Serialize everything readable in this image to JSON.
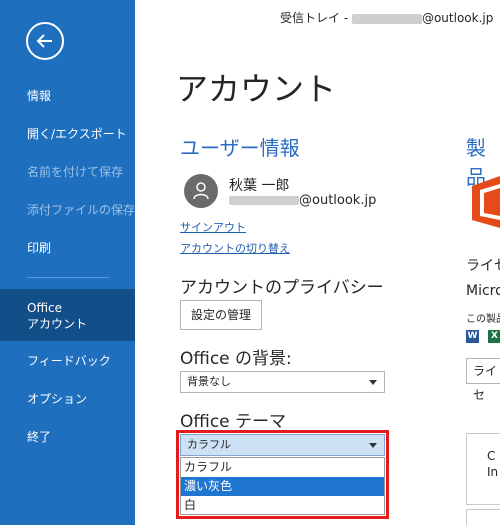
{
  "window": {
    "title_prefix": "受信トレイ - ",
    "title_suffix": "@outlook.jp"
  },
  "sidebar": {
    "items": [
      {
        "label": "情報"
      },
      {
        "label": "開く/エクスポート"
      },
      {
        "label": "名前を付けて保存"
      },
      {
        "label": "添付ファイルの保存"
      },
      {
        "label": "印刷"
      },
      {
        "label_line1": "Office",
        "label_line2": "アカウント"
      },
      {
        "label": "フィードバック"
      },
      {
        "label": "オプション"
      },
      {
        "label": "終了"
      }
    ]
  },
  "main": {
    "page_title": "アカウント",
    "user_info": {
      "section_title": "ユーザー情報",
      "name": "秋葉 一郎",
      "email_suffix": "@outlook.jp",
      "sign_out": "サインアウト",
      "switch_account": "アカウントの切り替え"
    },
    "privacy": {
      "heading": "アカウントのプライバシー",
      "manage_button": "設定の管理"
    },
    "background": {
      "heading": "Office の背景:",
      "selected": "背景なし"
    },
    "theme": {
      "heading": "Office テーマ",
      "selected": "カラフル",
      "options": [
        "カラフル",
        "濃い灰色",
        "白"
      ],
      "highlighted_option": "濃い灰色"
    }
  },
  "product_panel": {
    "section_title": "製品",
    "line1": "ライセ",
    "line2": "Micro",
    "line3": "この製品",
    "button_label": "ライセ",
    "tile_line1": "C",
    "tile_line2": "In",
    "app_icons": [
      {
        "name": "word",
        "letter": "W",
        "color": "#2b5797"
      },
      {
        "name": "excel",
        "letter": "X",
        "color": "#1e7145"
      }
    ],
    "logo_color": "#e64a19"
  }
}
